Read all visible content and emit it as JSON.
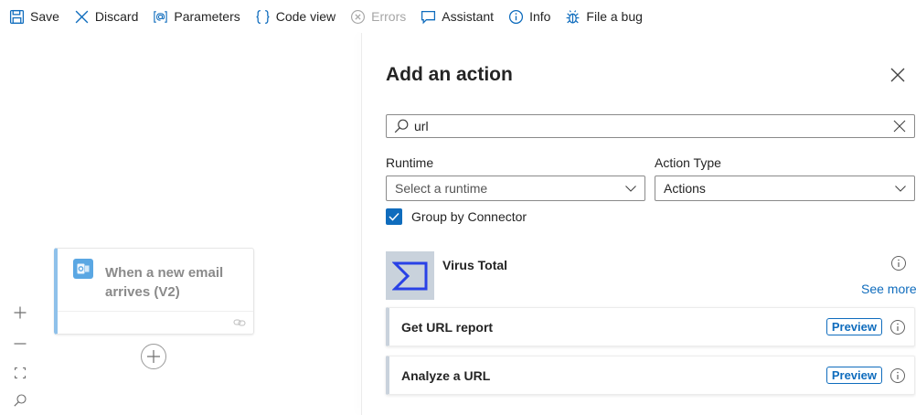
{
  "toolbar": {
    "items": [
      {
        "label": "Save",
        "icon": "save-icon"
      },
      {
        "label": "Discard",
        "icon": "discard-icon"
      },
      {
        "label": "Parameters",
        "icon": "parameters-icon"
      },
      {
        "label": "Code view",
        "icon": "code-view-icon"
      },
      {
        "label": "Errors",
        "icon": "errors-icon",
        "disabled": true
      },
      {
        "label": "Assistant",
        "icon": "assistant-icon"
      },
      {
        "label": "Info",
        "icon": "info-icon"
      },
      {
        "label": "File a bug",
        "icon": "bug-icon"
      }
    ]
  },
  "canvas": {
    "trigger": {
      "title": "When a new email arrives (V2)",
      "icon": "outlook-icon"
    },
    "zoom": [
      "zoom-in-icon",
      "zoom-out-icon",
      "fit-view-icon",
      "search-icon"
    ]
  },
  "panel": {
    "title": "Add an action",
    "search": {
      "value": "url"
    },
    "runtime": {
      "label": "Runtime",
      "value": "Select a runtime"
    },
    "action_type": {
      "label": "Action Type",
      "value": "Actions"
    },
    "group_by": {
      "label": "Group by Connector",
      "checked": true
    },
    "connector": {
      "name": "Virus Total",
      "see_more": "See more"
    },
    "actions": [
      {
        "name": "Get URL report",
        "badge": "Preview"
      },
      {
        "name": "Analyze a URL",
        "badge": "Preview"
      }
    ]
  },
  "colors": {
    "accent": "#0f6cbd",
    "connector_bg": "#c9d2dc",
    "trigger_border": "#8fc1ea"
  }
}
